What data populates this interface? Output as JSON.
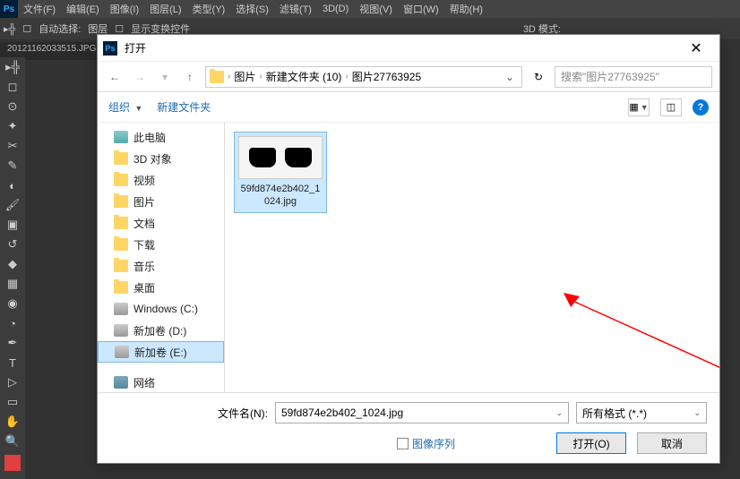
{
  "ps_menu": [
    "文件(F)",
    "编辑(E)",
    "图像(I)",
    "图层(L)",
    "类型(Y)",
    "选择(S)",
    "滤镜(T)",
    "3D(D)",
    "视图(V)",
    "窗口(W)",
    "帮助(H)"
  ],
  "ps_toolbar2": {
    "auto_select": "自动选择:",
    "layer": "图层",
    "show_controls": "显示变换控件",
    "mode_3d": "3D 模式:"
  },
  "ps_tab": "20121162033515.JPG @",
  "dialog": {
    "title": "打开",
    "breadcrumb": [
      "图片",
      "新建文件夹 (10)",
      "图片27763925"
    ],
    "search_placeholder": "搜索\"图片27763925\"",
    "organize": "组织",
    "new_folder": "新建文件夹",
    "sidebar": [
      {
        "label": "此电脑",
        "icon": "pc"
      },
      {
        "label": "3D 对象",
        "icon": "folder"
      },
      {
        "label": "视频",
        "icon": "folder"
      },
      {
        "label": "图片",
        "icon": "folder"
      },
      {
        "label": "文档",
        "icon": "folder"
      },
      {
        "label": "下载",
        "icon": "folder"
      },
      {
        "label": "音乐",
        "icon": "folder"
      },
      {
        "label": "桌面",
        "icon": "folder"
      },
      {
        "label": "Windows (C:)",
        "icon": "drive"
      },
      {
        "label": "新加卷 (D:)",
        "icon": "drive"
      },
      {
        "label": "新加卷 (E:)",
        "icon": "drive",
        "active": true
      },
      {
        "label": "",
        "icon": "spacer"
      },
      {
        "label": "网络",
        "icon": "net"
      }
    ],
    "file": {
      "name": "59fd874e2b402_1024.jpg"
    },
    "filename_label": "文件名(N):",
    "filetype": "所有格式 (*.*)",
    "image_sequence": "图像序列",
    "open_btn": "打开(O)",
    "cancel_btn": "取消"
  }
}
